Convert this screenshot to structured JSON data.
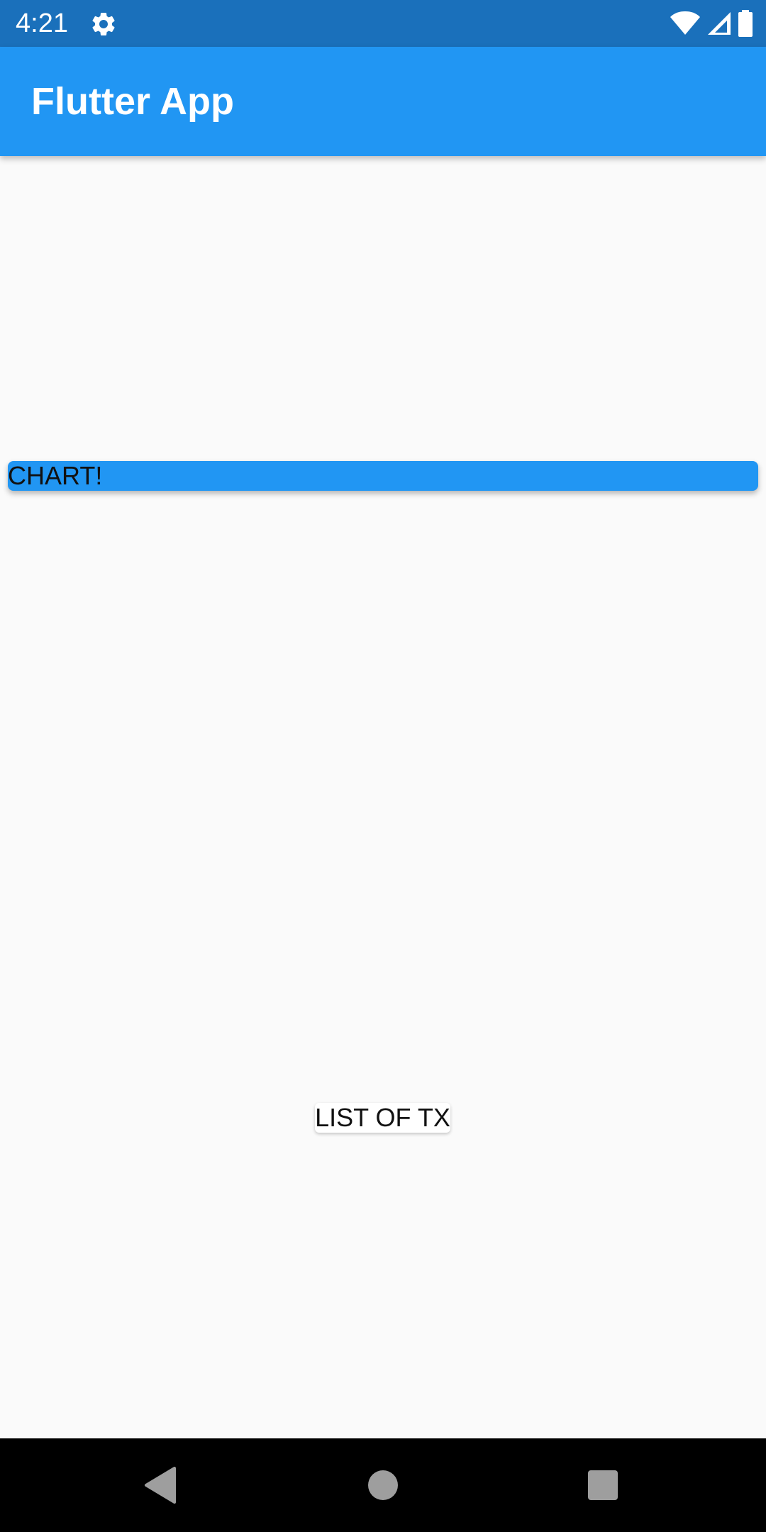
{
  "status_bar": {
    "time": "4:21",
    "icons": [
      "settings-gear-icon",
      "wifi-icon",
      "cellular-signal-icon",
      "battery-icon"
    ]
  },
  "app_bar": {
    "title": "Flutter App",
    "color": "#2196f3"
  },
  "main": {
    "chart_card": {
      "label": "CHART!",
      "color": "#2196f3"
    },
    "list_card": {
      "label": "LIST OF TX"
    }
  },
  "nav_bar": {
    "icons": [
      "back-icon",
      "home-icon",
      "recents-icon"
    ]
  }
}
